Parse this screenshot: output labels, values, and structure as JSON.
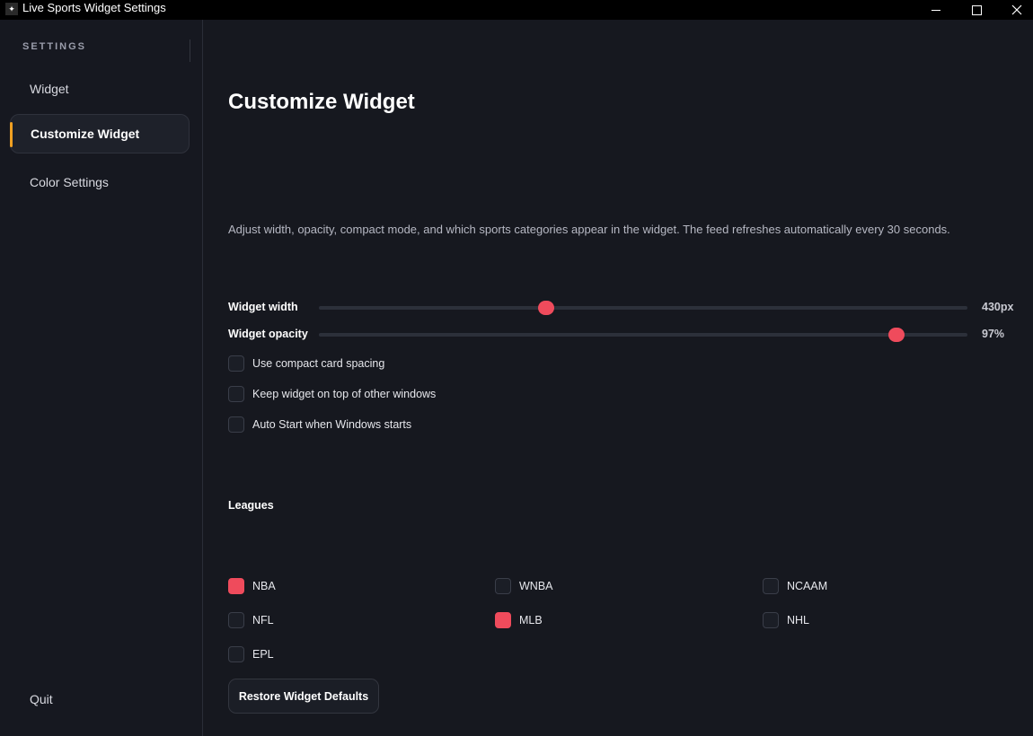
{
  "window": {
    "title": "Live Sports Widget Settings",
    "app_icon": "sports-app-icon"
  },
  "sidebar": {
    "heading": "SETTINGS",
    "items": [
      {
        "label": "Widget",
        "active": false
      },
      {
        "label": "Customize Widget",
        "active": true
      },
      {
        "label": "Color Settings",
        "active": false
      }
    ],
    "quit_label": "Quit"
  },
  "main": {
    "title": "Customize Widget",
    "description": "Adjust width, opacity, compact mode, and which sports categories appear in the widget. The feed refreshes automatically every 30 seconds.",
    "sliders": {
      "width": {
        "label": "Widget width",
        "value_text": "430px",
        "fraction": 0.35
      },
      "opacity": {
        "label": "Widget opacity",
        "value_text": "97%",
        "fraction": 0.89
      }
    },
    "options": [
      {
        "label": "Use compact card spacing",
        "checked": false
      },
      {
        "label": "Keep widget on top of other windows",
        "checked": false
      },
      {
        "label": "Auto Start when Windows starts",
        "checked": false
      }
    ],
    "leagues_heading": "Leagues",
    "leagues": [
      {
        "label": "NBA",
        "checked": true
      },
      {
        "label": "WNBA",
        "checked": false
      },
      {
        "label": "NCAAM",
        "checked": false
      },
      {
        "label": "NFL",
        "checked": false
      },
      {
        "label": "MLB",
        "checked": true
      },
      {
        "label": "NHL",
        "checked": false
      },
      {
        "label": "EPL",
        "checked": false
      }
    ],
    "restore_label": "Restore Widget Defaults"
  },
  "colors": {
    "accent": "#ef4b5c",
    "nav_indicator": "#f0a022",
    "background": "#16181f"
  }
}
